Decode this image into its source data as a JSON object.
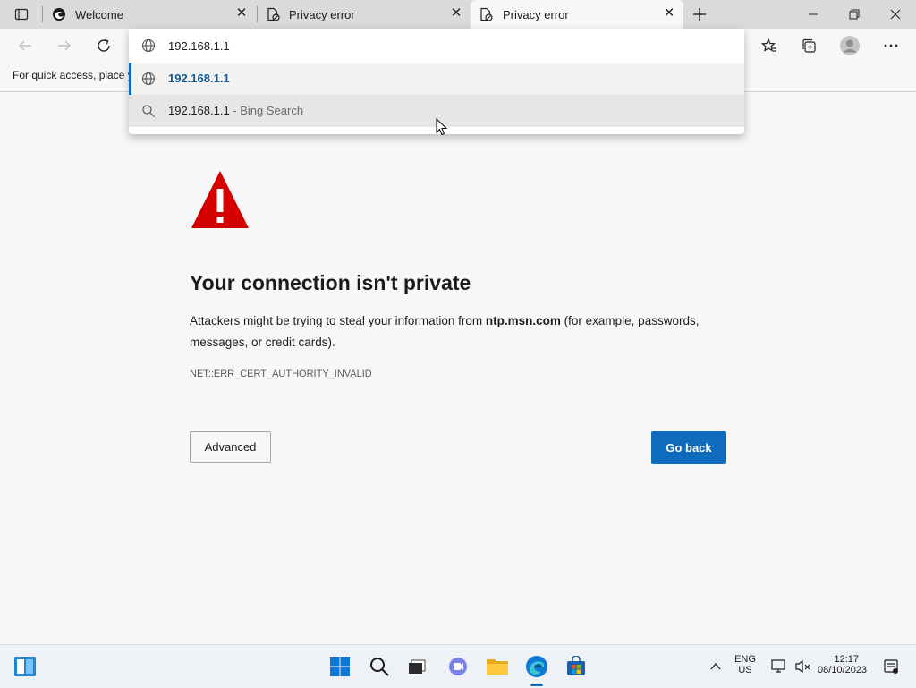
{
  "tabs": [
    {
      "title": "Welcome",
      "icon": "edge-icon"
    },
    {
      "title": "Privacy error",
      "icon": "broken-page-icon"
    },
    {
      "title": "Privacy error",
      "icon": "broken-page-icon",
      "active": true
    }
  ],
  "address_bar": {
    "value": "192.168.1.1"
  },
  "favorites_bar": {
    "text": "For quick access, place y"
  },
  "suggestions": [
    {
      "text": "192.168.1.1",
      "suffix": "",
      "icon": "globe-icon",
      "selected": true
    },
    {
      "text": "192.168.1.1",
      "suffix": " - Bing Search",
      "icon": "search-icon",
      "selected": false
    }
  ],
  "error_page": {
    "heading": "Your connection isn't private",
    "desc_before": "Attackers might be trying to steal your information from ",
    "desc_domain": "ntp.msn.com",
    "desc_after": " (for example, passwords, messages, or credit cards).",
    "error_code": "NET::ERR_CERT_AUTHORITY_INVALID",
    "advanced_label": "Advanced",
    "go_back_label": "Go back",
    "warning_icon": "warning-triangle-icon"
  },
  "taskbar": {
    "lang_top": "ENG",
    "lang_bottom": "US",
    "time": "12:17",
    "date": "08/10/2023"
  },
  "colors": {
    "accent": "#0f6cbd",
    "warning": "#d40000",
    "tabbar": "#dadada",
    "page_bg": "#f7f7f7"
  }
}
